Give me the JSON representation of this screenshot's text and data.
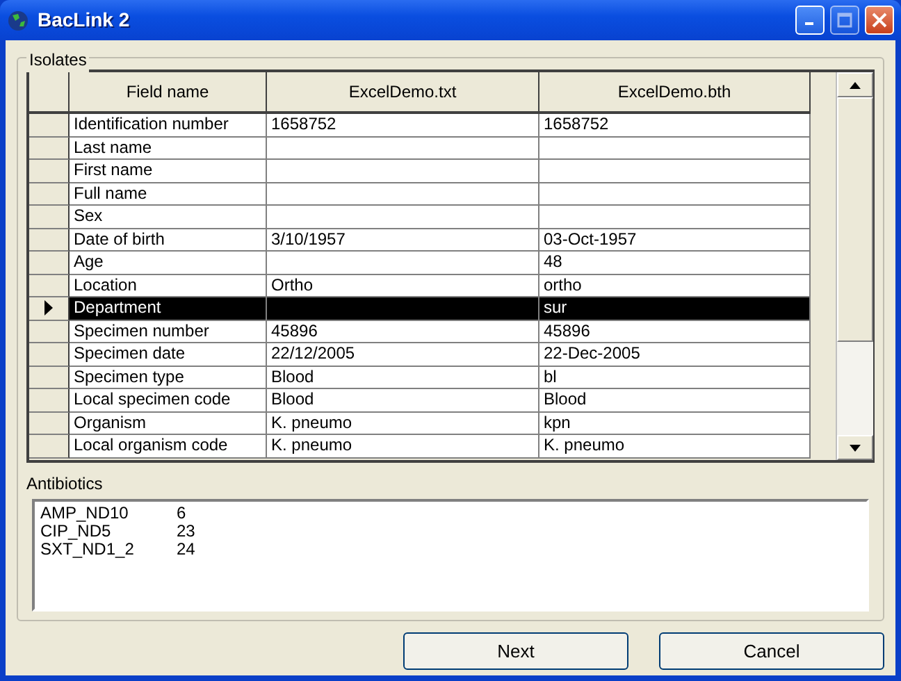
{
  "window": {
    "title": "BacLink 2"
  },
  "isolates": {
    "label": "Isolates",
    "columns": [
      "Field name",
      "ExcelDemo.txt",
      "ExcelDemo.bth"
    ],
    "rows": [
      {
        "cells": [
          "Identification number",
          "1658752",
          "1658752"
        ],
        "selected": false
      },
      {
        "cells": [
          "Last name",
          "",
          ""
        ],
        "selected": false
      },
      {
        "cells": [
          "First name",
          "",
          ""
        ],
        "selected": false
      },
      {
        "cells": [
          "Full name",
          "",
          ""
        ],
        "selected": false
      },
      {
        "cells": [
          "Sex",
          "",
          ""
        ],
        "selected": false
      },
      {
        "cells": [
          "Date of birth",
          "3/10/1957",
          "03-Oct-1957"
        ],
        "selected": false
      },
      {
        "cells": [
          "Age",
          "",
          "48"
        ],
        "selected": false
      },
      {
        "cells": [
          "Location",
          "Ortho",
          "ortho"
        ],
        "selected": false
      },
      {
        "cells": [
          "Department",
          "",
          "sur"
        ],
        "selected": true
      },
      {
        "cells": [
          "Specimen number",
          "45896",
          "45896"
        ],
        "selected": false
      },
      {
        "cells": [
          "Specimen date",
          "22/12/2005",
          "22-Dec-2005"
        ],
        "selected": false
      },
      {
        "cells": [
          "Specimen type",
          "Blood",
          "bl"
        ],
        "selected": false
      },
      {
        "cells": [
          "Local specimen code",
          "Blood",
          "Blood"
        ],
        "selected": false
      },
      {
        "cells": [
          "Organism",
          "K. pneumo",
          "kpn"
        ],
        "selected": false
      },
      {
        "cells": [
          "Local organism code",
          "K. pneumo",
          "K. pneumo"
        ],
        "selected": false
      }
    ]
  },
  "antibiotics": {
    "label": "Antibiotics",
    "items": [
      {
        "name": "AMP_ND10",
        "value": "6"
      },
      {
        "name": "CIP_ND5",
        "value": "23"
      },
      {
        "name": "SXT_ND1_2",
        "value": "24"
      }
    ]
  },
  "buttons": [
    "Next",
    "Cancel"
  ]
}
